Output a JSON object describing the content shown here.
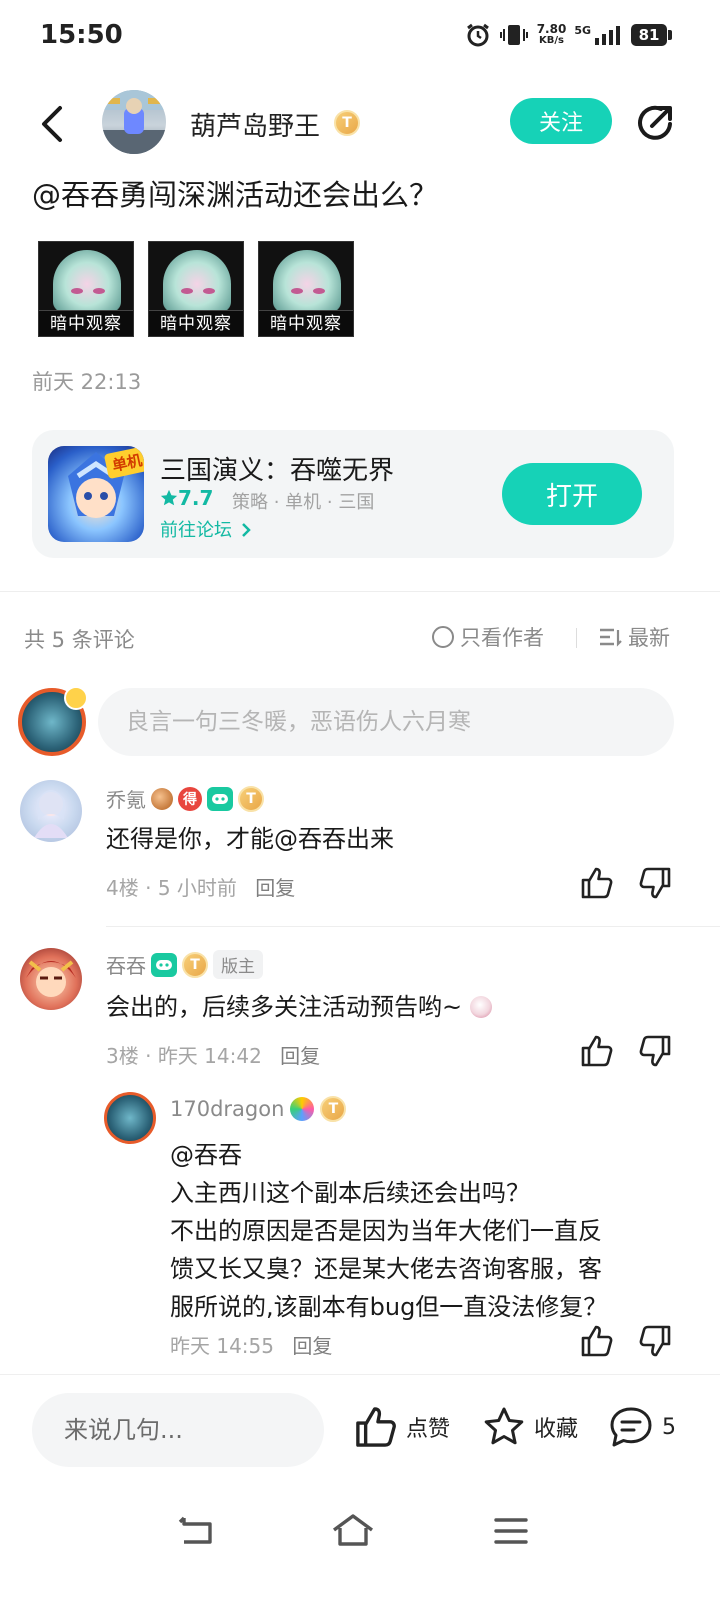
{
  "status": {
    "time": "15:50",
    "net_speed_value": "7.80",
    "net_speed_unit": "KB/s",
    "network": "5G",
    "battery": "81"
  },
  "header": {
    "author_name": "葫芦岛野王",
    "author_level": "T",
    "follow_label": "关注",
    "icons": [
      "back-icon",
      "share-icon"
    ]
  },
  "post": {
    "title": "@吞吞勇闯深渊活动还会出么？",
    "stickers": [
      "暗中观察",
      "暗中观察",
      "暗中观察"
    ],
    "time": "前天 22:13"
  },
  "game_card": {
    "tag": "单机",
    "name": "三国演义：吞噬无界",
    "rating": "7.7",
    "tags": "策略 · 单机 · 三国",
    "forum_link": "前往论坛",
    "open_label": "打开"
  },
  "comments_bar": {
    "count_text": "共 5 条评论",
    "only_author": "只看作者",
    "sort": "最新"
  },
  "comment_input": {
    "placeholder": "良言一句三冬暖，恶语伤人六月寒"
  },
  "comments": [
    {
      "name": "乔氪",
      "badge_de": "得",
      "level": "T",
      "text": "还得是你，才能@吞吞出来",
      "floor": "4楼",
      "time": "5 小时前",
      "reply": "回复"
    },
    {
      "name": "吞吞",
      "level": "T",
      "mod_badge": "版主",
      "text": "会出的，后续多关注活动预告哟~",
      "floor": "3楼",
      "time": "昨天 14:42",
      "reply": "回复",
      "sub_reply": {
        "name": "170dragon",
        "level": "T",
        "lines": [
          "@吞吞",
          "入主西川这个副本后续还会出吗？",
          "不出的原因是否是因为当年大佬们一直反",
          "馈又长又臭？还是某大佬去咨询客服，客",
          "服所说的,该副本有bug但一直没法修复？"
        ],
        "time": "昨天 14:55",
        "reply": "回复"
      }
    }
  ],
  "bottom_bar": {
    "input_placeholder": "来说几句...",
    "like_label": "点赞",
    "favorite_label": "收藏",
    "comment_count": "5"
  },
  "colors": {
    "accent": "#16d2b7",
    "accent_text": "#12b9a3",
    "muted": "#8a8a8a"
  }
}
